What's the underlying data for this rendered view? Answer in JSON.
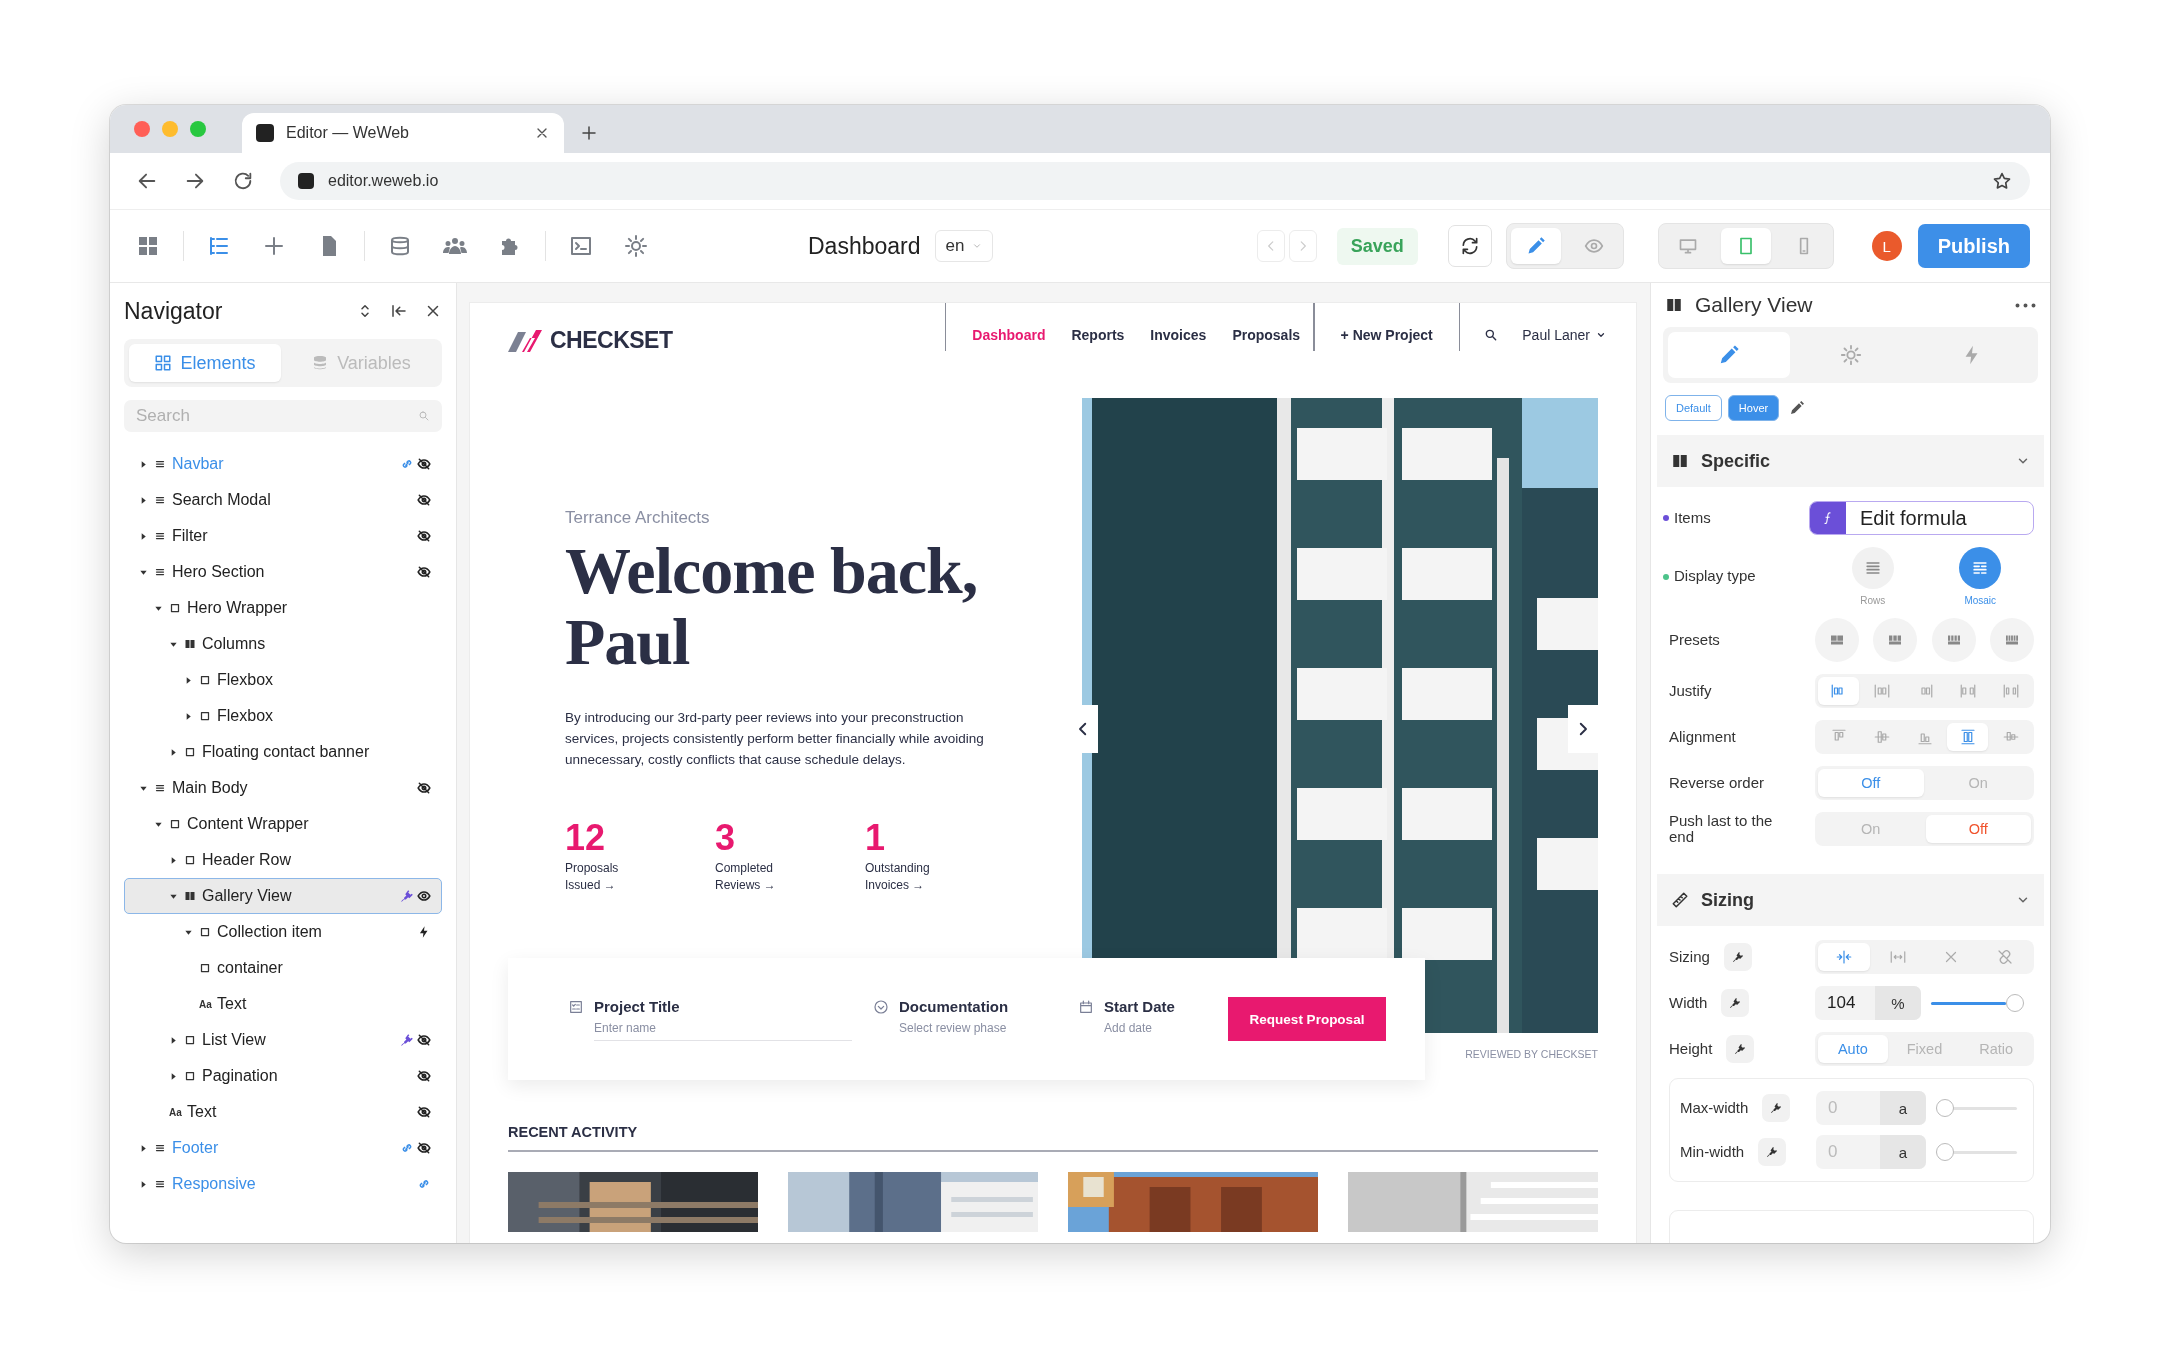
{
  "browser": {
    "tab_title": "Editor — WeWeb",
    "url": "editor.weweb.io"
  },
  "toolbar": {
    "tools": [
      {
        "kind": "apps",
        "selected": false
      },
      {
        "kind": "layers",
        "selected": true
      },
      {
        "kind": "add",
        "selected": false
      },
      {
        "kind": "pages",
        "selected": false
      },
      {
        "kind": "data",
        "selected": false
      },
      {
        "kind": "users",
        "selected": false
      },
      {
        "kind": "plugins",
        "selected": false
      },
      {
        "kind": "console",
        "selected": false
      },
      {
        "kind": "settings",
        "selected": false
      }
    ],
    "page_title": "Dashboard",
    "language": "en",
    "save_status": "Saved",
    "modes": [
      {
        "kind": "edit",
        "selected": true
      },
      {
        "kind": "preview",
        "selected": false
      }
    ],
    "devices": [
      {
        "kind": "desktop",
        "selected": false
      },
      {
        "kind": "tablet",
        "selected": true
      },
      {
        "kind": "mobile",
        "selected": false
      }
    ],
    "avatar": "L",
    "publish": "Publish"
  },
  "navigator": {
    "title": "Navigator",
    "tabs": [
      {
        "label": "Elements",
        "kind": "elements",
        "selected": true
      },
      {
        "label": "Variables",
        "kind": "variables",
        "selected": false
      }
    ],
    "search": {
      "placeholder": "Search"
    },
    "tree": [
      {
        "label": "Navbar",
        "kind": "section",
        "expanded": false,
        "linked": true,
        "selected": false,
        "badges": [
          {
            "kind": "link"
          },
          {
            "kind": "hidden"
          }
        ]
      },
      {
        "label": "Search Modal",
        "kind": "section",
        "expanded": false,
        "linked": false,
        "selected": false,
        "badges": [
          {
            "kind": "hidden"
          }
        ]
      },
      {
        "label": "Filter",
        "kind": "section",
        "expanded": false,
        "linked": false,
        "selected": false,
        "badges": [
          {
            "kind": "hidden"
          }
        ]
      },
      {
        "label": "Hero Section",
        "kind": "section",
        "expanded": true,
        "linked": false,
        "selected": false,
        "badges": [
          {
            "kind": "hidden"
          }
        ],
        "children": [
          {
            "label": "Hero Wrapper",
            "kind": "div",
            "expanded": true,
            "linked": false,
            "selected": false,
            "children": [
              {
                "label": "Columns",
                "kind": "columns",
                "expanded": true,
                "linked": false,
                "selected": false,
                "children": [
                  {
                    "label": "Flexbox",
                    "kind": "div",
                    "expanded": false,
                    "linked": false,
                    "selected": false
                  },
                  {
                    "label": "Flexbox",
                    "kind": "div",
                    "expanded": false,
                    "linked": false,
                    "selected": false
                  }
                ]
              },
              {
                "label": "Floating contact banner",
                "kind": "div",
                "expanded": false,
                "linked": false,
                "selected": false
              }
            ]
          }
        ]
      },
      {
        "label": "Main Body",
        "kind": "section",
        "expanded": true,
        "linked": false,
        "selected": false,
        "badges": [
          {
            "kind": "hidden"
          }
        ],
        "children": [
          {
            "label": "Content Wrapper",
            "kind": "div",
            "expanded": true,
            "linked": false,
            "selected": false,
            "children": [
              {
                "label": "Header Row",
                "kind": "div",
                "expanded": false,
                "linked": false,
                "selected": false
              },
              {
                "label": "Gallery View",
                "kind": "columns",
                "expanded": true,
                "linked": false,
                "selected": true,
                "badges": [
                  {
                    "kind": "plug"
                  },
                  {
                    "kind": "visible"
                  }
                ],
                "children": [
                  {
                    "label": "Collection item",
                    "kind": "div",
                    "expanded": true,
                    "linked": false,
                    "selected": false,
                    "badges": [
                      {
                        "kind": "bolt"
                      }
                    ],
                    "children": [
                      {
                        "label": "container",
                        "kind": "div",
                        "linked": false,
                        "selected": false
                      },
                      {
                        "label": "Text",
                        "kind": "text",
                        "glyph": "Aa",
                        "linked": false,
                        "selected": false
                      }
                    ]
                  }
                ]
              },
              {
                "label": "List View",
                "kind": "div",
                "expanded": false,
                "linked": false,
                "selected": false,
                "badges": [
                  {
                    "kind": "plug"
                  },
                  {
                    "kind": "hidden"
                  }
                ]
              },
              {
                "label": "Pagination",
                "kind": "div",
                "expanded": false,
                "linked": false,
                "selected": false,
                "badges": [
                  {
                    "kind": "hidden"
                  }
                ]
              },
              {
                "label": "Text",
                "kind": "text",
                "glyph": "Aa",
                "linked": false,
                "selected": false,
                "badges": [
                  {
                    "kind": "hidden"
                  }
                ]
              }
            ]
          }
        ]
      },
      {
        "label": "Footer",
        "kind": "section",
        "expanded": false,
        "linked": true,
        "selected": false,
        "badges": [
          {
            "kind": "link"
          },
          {
            "kind": "hidden"
          }
        ]
      },
      {
        "label": "Responsive",
        "kind": "section",
        "expanded": false,
        "linked": true,
        "selected": false,
        "badges": [
          {
            "kind": "link"
          }
        ]
      }
    ]
  },
  "site": {
    "logo": "CHECKSET",
    "nav": [
      {
        "label": "Dashboard",
        "selected": true
      },
      {
        "label": "Reports",
        "selected": false
      },
      {
        "label": "Invoices",
        "selected": false
      },
      {
        "label": "Proposals",
        "selected": false
      }
    ],
    "new_project": "+ New Project",
    "user": "Paul Laner",
    "hero": {
      "eyebrow": "Terrance Architects",
      "heading": "Welcome back, Paul",
      "body": "By introducing our 3rd-party peer reviews into your preconstruction services, projects consistently perform better financially while avoiding unnecessary, costly conflicts that cause schedule delays.",
      "stats": [
        {
          "value": "12",
          "label": "Proposals Issued →"
        },
        {
          "value": "3",
          "label": "Completed Reviews →"
        },
        {
          "value": "1",
          "label": "Outstanding Invoices →"
        }
      ]
    },
    "form": {
      "fields": [
        {
          "kind": "text",
          "label": "Project Title",
          "placeholder": "Enter name"
        },
        {
          "kind": "select",
          "label": "Documentation",
          "placeholder": "Select review phase"
        },
        {
          "kind": "date",
          "label": "Start Date",
          "placeholder": "Add date"
        }
      ],
      "button": "Request Proposal"
    },
    "credit": "REVIEWED BY CHECKSET",
    "recent": {
      "title": "RECENT ACTIVITY"
    }
  },
  "inspector": {
    "title": "Gallery View",
    "tabs": [
      {
        "kind": "style",
        "selected": true
      },
      {
        "kind": "settings",
        "selected": false
      },
      {
        "kind": "workflows",
        "selected": false
      }
    ],
    "states": [
      {
        "label": "Default",
        "selected": false
      },
      {
        "label": "Hover",
        "selected": true
      }
    ],
    "sections": [
      {
        "title": "Specific",
        "kind": "specific",
        "expanded": true,
        "rows": [
          {
            "kind": "formula",
            "label": "Items",
            "color": "#6b4fd8",
            "value": "Edit formula"
          },
          {
            "kind": "choice",
            "label": "Display type",
            "color": "#4cc38a",
            "options": [
              {
                "label": "Rows",
                "kind": "rows",
                "selected": false
              },
              {
                "label": "Mosaic",
                "kind": "mosaic",
                "selected": true
              }
            ]
          },
          {
            "kind": "round-icons",
            "label": "Presets",
            "options": [
              {
                "kind": "preset-2",
                "selected": false
              },
              {
                "kind": "preset-3",
                "selected": false
              },
              {
                "kind": "preset-4",
                "selected": false
              },
              {
                "kind": "preset-5",
                "selected": false
              }
            ]
          },
          {
            "kind": "segmented-icons",
            "label": "Justify",
            "options": [
              {
                "kind": "j-start",
                "selected": true
              },
              {
                "kind": "j-center",
                "selected": false
              },
              {
                "kind": "j-end",
                "selected": false
              },
              {
                "kind": "j-between",
                "selected": false
              },
              {
                "kind": "j-around",
                "selected": false
              }
            ]
          },
          {
            "kind": "segmented-icons",
            "label": "Alignment",
            "options": [
              {
                "kind": "a-top",
                "selected": false
              },
              {
                "kind": "a-center",
                "selected": false
              },
              {
                "kind": "a-bottom",
                "selected": false
              },
              {
                "kind": "a-stretch",
                "selected": true
              },
              {
                "kind": "a-baseline",
                "selected": false
              }
            ]
          },
          {
            "kind": "toggle",
            "label": "Reverse order",
            "options": [
              {
                "label": "Off",
                "selected": true,
                "color": "#3b8fe8"
              },
              {
                "label": "On",
                "selected": false
              }
            ]
          },
          {
            "kind": "toggle",
            "label": "Push last to the end",
            "options": [
              {
                "label": "On",
                "selected": false
              },
              {
                "label": "Off",
                "selected": true,
                "color": "#f0532d"
              }
            ]
          }
        ]
      },
      {
        "title": "Sizing",
        "kind": "sizing",
        "expanded": true,
        "rows": [
          {
            "kind": "segmented-icons",
            "label": "Sizing",
            "bindable": true,
            "options": [
              {
                "kind": "fit",
                "selected": true
              },
              {
                "kind": "fill",
                "selected": false
              },
              {
                "kind": "none",
                "selected": false
              },
              {
                "kind": "unlink",
                "selected": false
              }
            ]
          },
          {
            "kind": "number-slider",
            "label": "Width",
            "bindable": true,
            "value": "104",
            "unit": "%",
            "level": 1
          },
          {
            "kind": "toggle",
            "label": "Height",
            "bindable": true,
            "options": [
              {
                "label": "Auto",
                "selected": true,
                "color": "#3b8fe8"
              },
              {
                "label": "Fixed",
                "selected": false
              },
              {
                "label": "Ratio",
                "selected": false
              }
            ]
          },
          {
            "kind": "group",
            "rows": [
              {
                "kind": "number-slider",
                "label": "Max-width",
                "bindable": true,
                "placeholder": "0",
                "unit": "a",
                "level": 0
              },
              {
                "kind": "number-slider",
                "label": "Min-width",
                "bindable": true,
                "placeholder": "0",
                "unit": "a",
                "level": 0
              }
            ]
          }
        ]
      }
    ]
  }
}
